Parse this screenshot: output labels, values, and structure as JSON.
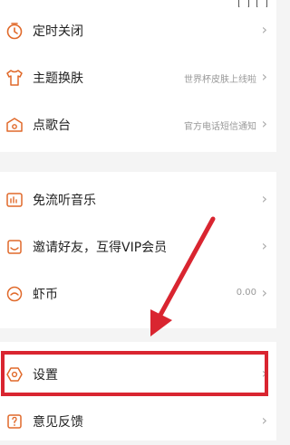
{
  "menu": {
    "group1": [
      {
        "label": "定时关闭",
        "icon": "timer-icon",
        "sub": "",
        "chevron": "›"
      },
      {
        "label": "主题换肤",
        "icon": "tshirt-icon",
        "sub": "世界杯皮肤上线啦",
        "chevron": "›"
      },
      {
        "label": "点歌台",
        "icon": "song-request-icon",
        "sub": "官方电话短信通知",
        "chevron": "›"
      }
    ],
    "group2": [
      {
        "label": "免流听音乐",
        "icon": "free-data-icon",
        "sub": "",
        "chevron": "›"
      },
      {
        "label": "邀请好友，互得VIP会员",
        "icon": "invite-icon",
        "sub": "",
        "chevron": "›"
      },
      {
        "label": "虾币",
        "icon": "coin-icon",
        "sub": "0.00",
        "chevron": "›"
      }
    ],
    "group3": [
      {
        "label": "设置",
        "icon": "settings-icon",
        "sub": "",
        "chevron": "›"
      },
      {
        "label": "意见反馈",
        "icon": "feedback-icon",
        "sub": "",
        "chevron": "›"
      }
    ]
  },
  "annotation": {
    "color": "#d92530",
    "target": "settings"
  },
  "colors": {
    "accent": "#e0692a",
    "text": "#222222",
    "subtext": "#999999"
  }
}
